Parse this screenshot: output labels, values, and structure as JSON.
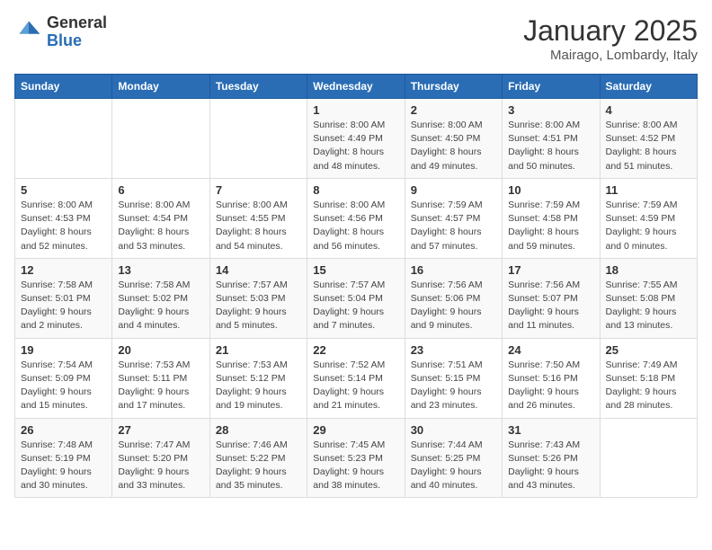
{
  "logo": {
    "general": "General",
    "blue": "Blue"
  },
  "header": {
    "month_year": "January 2025",
    "location": "Mairago, Lombardy, Italy"
  },
  "weekdays": [
    "Sunday",
    "Monday",
    "Tuesday",
    "Wednesday",
    "Thursday",
    "Friday",
    "Saturday"
  ],
  "weeks": [
    [
      {
        "day": "",
        "sunrise": "",
        "sunset": "",
        "daylight": ""
      },
      {
        "day": "",
        "sunrise": "",
        "sunset": "",
        "daylight": ""
      },
      {
        "day": "",
        "sunrise": "",
        "sunset": "",
        "daylight": ""
      },
      {
        "day": "1",
        "sunrise": "Sunrise: 8:00 AM",
        "sunset": "Sunset: 4:49 PM",
        "daylight": "Daylight: 8 hours and 48 minutes."
      },
      {
        "day": "2",
        "sunrise": "Sunrise: 8:00 AM",
        "sunset": "Sunset: 4:50 PM",
        "daylight": "Daylight: 8 hours and 49 minutes."
      },
      {
        "day": "3",
        "sunrise": "Sunrise: 8:00 AM",
        "sunset": "Sunset: 4:51 PM",
        "daylight": "Daylight: 8 hours and 50 minutes."
      },
      {
        "day": "4",
        "sunrise": "Sunrise: 8:00 AM",
        "sunset": "Sunset: 4:52 PM",
        "daylight": "Daylight: 8 hours and 51 minutes."
      }
    ],
    [
      {
        "day": "5",
        "sunrise": "Sunrise: 8:00 AM",
        "sunset": "Sunset: 4:53 PM",
        "daylight": "Daylight: 8 hours and 52 minutes."
      },
      {
        "day": "6",
        "sunrise": "Sunrise: 8:00 AM",
        "sunset": "Sunset: 4:54 PM",
        "daylight": "Daylight: 8 hours and 53 minutes."
      },
      {
        "day": "7",
        "sunrise": "Sunrise: 8:00 AM",
        "sunset": "Sunset: 4:55 PM",
        "daylight": "Daylight: 8 hours and 54 minutes."
      },
      {
        "day": "8",
        "sunrise": "Sunrise: 8:00 AM",
        "sunset": "Sunset: 4:56 PM",
        "daylight": "Daylight: 8 hours and 56 minutes."
      },
      {
        "day": "9",
        "sunrise": "Sunrise: 7:59 AM",
        "sunset": "Sunset: 4:57 PM",
        "daylight": "Daylight: 8 hours and 57 minutes."
      },
      {
        "day": "10",
        "sunrise": "Sunrise: 7:59 AM",
        "sunset": "Sunset: 4:58 PM",
        "daylight": "Daylight: 8 hours and 59 minutes."
      },
      {
        "day": "11",
        "sunrise": "Sunrise: 7:59 AM",
        "sunset": "Sunset: 4:59 PM",
        "daylight": "Daylight: 9 hours and 0 minutes."
      }
    ],
    [
      {
        "day": "12",
        "sunrise": "Sunrise: 7:58 AM",
        "sunset": "Sunset: 5:01 PM",
        "daylight": "Daylight: 9 hours and 2 minutes."
      },
      {
        "day": "13",
        "sunrise": "Sunrise: 7:58 AM",
        "sunset": "Sunset: 5:02 PM",
        "daylight": "Daylight: 9 hours and 4 minutes."
      },
      {
        "day": "14",
        "sunrise": "Sunrise: 7:57 AM",
        "sunset": "Sunset: 5:03 PM",
        "daylight": "Daylight: 9 hours and 5 minutes."
      },
      {
        "day": "15",
        "sunrise": "Sunrise: 7:57 AM",
        "sunset": "Sunset: 5:04 PM",
        "daylight": "Daylight: 9 hours and 7 minutes."
      },
      {
        "day": "16",
        "sunrise": "Sunrise: 7:56 AM",
        "sunset": "Sunset: 5:06 PM",
        "daylight": "Daylight: 9 hours and 9 minutes."
      },
      {
        "day": "17",
        "sunrise": "Sunrise: 7:56 AM",
        "sunset": "Sunset: 5:07 PM",
        "daylight": "Daylight: 9 hours and 11 minutes."
      },
      {
        "day": "18",
        "sunrise": "Sunrise: 7:55 AM",
        "sunset": "Sunset: 5:08 PM",
        "daylight": "Daylight: 9 hours and 13 minutes."
      }
    ],
    [
      {
        "day": "19",
        "sunrise": "Sunrise: 7:54 AM",
        "sunset": "Sunset: 5:09 PM",
        "daylight": "Daylight: 9 hours and 15 minutes."
      },
      {
        "day": "20",
        "sunrise": "Sunrise: 7:53 AM",
        "sunset": "Sunset: 5:11 PM",
        "daylight": "Daylight: 9 hours and 17 minutes."
      },
      {
        "day": "21",
        "sunrise": "Sunrise: 7:53 AM",
        "sunset": "Sunset: 5:12 PM",
        "daylight": "Daylight: 9 hours and 19 minutes."
      },
      {
        "day": "22",
        "sunrise": "Sunrise: 7:52 AM",
        "sunset": "Sunset: 5:14 PM",
        "daylight": "Daylight: 9 hours and 21 minutes."
      },
      {
        "day": "23",
        "sunrise": "Sunrise: 7:51 AM",
        "sunset": "Sunset: 5:15 PM",
        "daylight": "Daylight: 9 hours and 23 minutes."
      },
      {
        "day": "24",
        "sunrise": "Sunrise: 7:50 AM",
        "sunset": "Sunset: 5:16 PM",
        "daylight": "Daylight: 9 hours and 26 minutes."
      },
      {
        "day": "25",
        "sunrise": "Sunrise: 7:49 AM",
        "sunset": "Sunset: 5:18 PM",
        "daylight": "Daylight: 9 hours and 28 minutes."
      }
    ],
    [
      {
        "day": "26",
        "sunrise": "Sunrise: 7:48 AM",
        "sunset": "Sunset: 5:19 PM",
        "daylight": "Daylight: 9 hours and 30 minutes."
      },
      {
        "day": "27",
        "sunrise": "Sunrise: 7:47 AM",
        "sunset": "Sunset: 5:20 PM",
        "daylight": "Daylight: 9 hours and 33 minutes."
      },
      {
        "day": "28",
        "sunrise": "Sunrise: 7:46 AM",
        "sunset": "Sunset: 5:22 PM",
        "daylight": "Daylight: 9 hours and 35 minutes."
      },
      {
        "day": "29",
        "sunrise": "Sunrise: 7:45 AM",
        "sunset": "Sunset: 5:23 PM",
        "daylight": "Daylight: 9 hours and 38 minutes."
      },
      {
        "day": "30",
        "sunrise": "Sunrise: 7:44 AM",
        "sunset": "Sunset: 5:25 PM",
        "daylight": "Daylight: 9 hours and 40 minutes."
      },
      {
        "day": "31",
        "sunrise": "Sunrise: 7:43 AM",
        "sunset": "Sunset: 5:26 PM",
        "daylight": "Daylight: 9 hours and 43 minutes."
      },
      {
        "day": "",
        "sunrise": "",
        "sunset": "",
        "daylight": ""
      }
    ]
  ]
}
